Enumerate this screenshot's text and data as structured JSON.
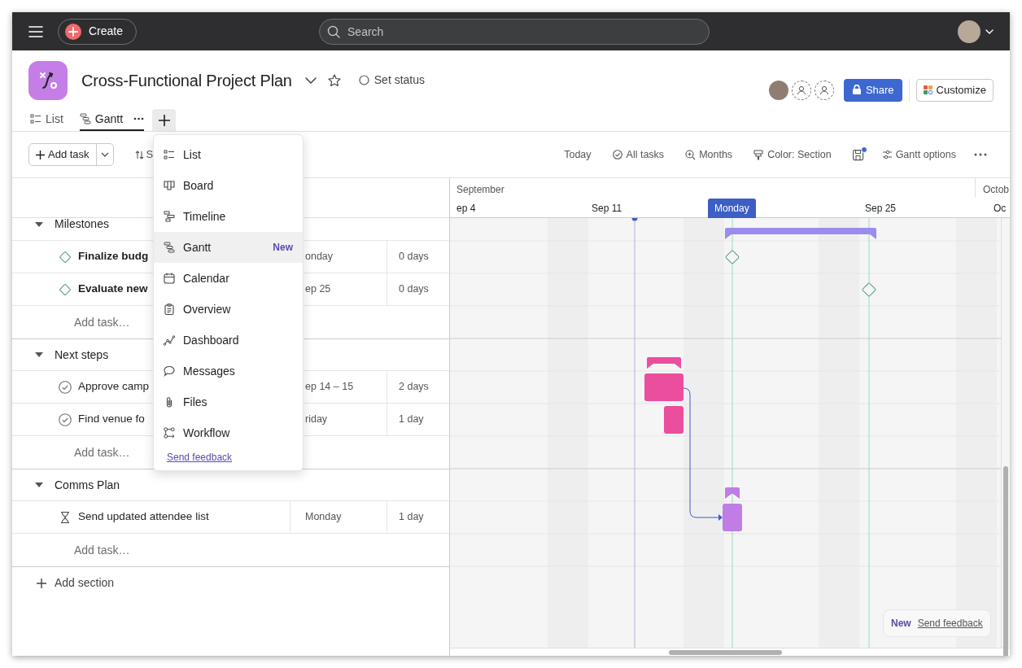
{
  "topbar": {
    "create_label": "Create",
    "search": {
      "placeholder": "Search"
    }
  },
  "project": {
    "title": "Cross-Functional Project Plan",
    "status_label": "Set status",
    "share_label": "Share",
    "customize_label": "Customize"
  },
  "views": [
    {
      "label": "List",
      "kind": "list",
      "selected": false
    },
    {
      "label": "Gantt",
      "kind": "gantt",
      "selected": true
    }
  ],
  "toolbar": {
    "add_task": "Add task",
    "sort": "S",
    "save_badge": true,
    "actions": [
      {
        "label": "Today",
        "kind": "today"
      },
      {
        "label": "All tasks",
        "kind": "filter"
      },
      {
        "label": "Months",
        "kind": "zoom"
      },
      {
        "label": "Color: Section",
        "kind": "color"
      },
      {
        "label": "Gantt options",
        "kind": "options"
      }
    ]
  },
  "view_menu": {
    "items": [
      {
        "label": "List",
        "kind": "list",
        "selected": false
      },
      {
        "label": "Board",
        "kind": "board",
        "selected": false
      },
      {
        "label": "Timeline",
        "kind": "timeline",
        "selected": false
      },
      {
        "label": "Gantt",
        "kind": "gantt",
        "selected": true,
        "badge": "New"
      },
      {
        "label": "Calendar",
        "kind": "calendar",
        "selected": false
      },
      {
        "label": "Overview",
        "kind": "overview",
        "selected": false
      },
      {
        "label": "Dashboard",
        "kind": "dashboard",
        "selected": false
      },
      {
        "label": "Messages",
        "kind": "messages",
        "selected": false
      },
      {
        "label": "Files",
        "kind": "files",
        "selected": false
      },
      {
        "label": "Workflow",
        "kind": "workflow",
        "selected": false
      }
    ],
    "feedback": "Send feedback"
  },
  "timeline": {
    "months": [
      "September",
      "Octob"
    ],
    "days": [
      {
        "label": "ep 4",
        "selected": false
      },
      {
        "label": "Sep 11",
        "selected": false
      },
      {
        "label": "Monday",
        "selected": true
      },
      {
        "label": "Sep 25",
        "selected": false
      },
      {
        "label": "Oc",
        "selected": false
      }
    ]
  },
  "sections": [
    {
      "name": "Milestones",
      "expanded": true,
      "color": "#9b8cf0",
      "add_task": "Add task…",
      "tasks": [
        {
          "kind": "milestone",
          "name": "Finalize budg",
          "date": "onday",
          "duration": "0 days"
        },
        {
          "kind": "milestone",
          "name": "Evaluate new",
          "date": "ep 25",
          "duration": "0 days"
        }
      ]
    },
    {
      "name": "Next steps",
      "expanded": true,
      "color": "#ea4e9d",
      "add_task": "Add task…",
      "tasks": [
        {
          "kind": "task",
          "name": "Approve camp",
          "date": "ep 14 – 15",
          "duration": "2 days"
        },
        {
          "kind": "task",
          "name": "Find venue fo",
          "date": "riday",
          "duration": "1 day"
        }
      ]
    },
    {
      "name": "Comms Plan",
      "expanded": true,
      "color": "#c17de6",
      "add_task": "Add task…",
      "tasks": [
        {
          "kind": "approval",
          "name": "Send updated attendee list",
          "date": "Monday",
          "duration": "1 day"
        }
      ]
    }
  ],
  "add_section": "Add section",
  "feedback_pill": {
    "badge": "New",
    "link": "Send feedback"
  }
}
